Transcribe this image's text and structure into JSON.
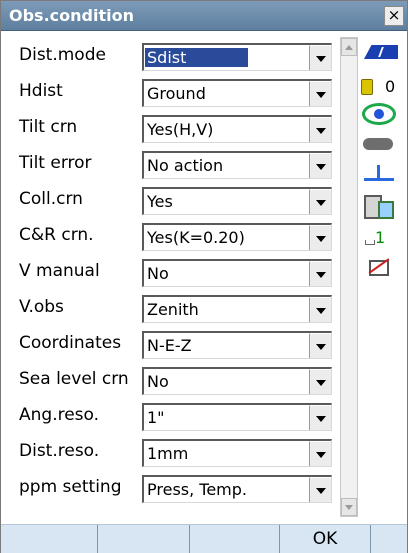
{
  "window": {
    "title": "Obs.condition",
    "close_label": "×"
  },
  "fields": [
    {
      "label": "Dist.mode",
      "value": "Sdist",
      "selected": true
    },
    {
      "label": "Hdist",
      "value": "Ground"
    },
    {
      "label": "Tilt crn",
      "value": "Yes(H,V)"
    },
    {
      "label": "Tilt error",
      "value": "No action"
    },
    {
      "label": "Coll.crn",
      "value": "Yes"
    },
    {
      "label": "C&R crn.",
      "value": "Yes(K=0.20)"
    },
    {
      "label": "V manual",
      "value": "No"
    },
    {
      "label": "V.obs",
      "value": "Zenith"
    },
    {
      "label": "Coordinates",
      "value": "N-E-Z"
    },
    {
      "label": "Sea level crn",
      "value": "No"
    },
    {
      "label": "Ang.reso.",
      "value": "1\""
    },
    {
      "label": "Dist.reso.",
      "value": "1mm"
    },
    {
      "label": "ppm setting",
      "value": "Press, Temp."
    }
  ],
  "status": {
    "prism_constant": "0",
    "input_mode": "1"
  },
  "softkeys": [
    "",
    "",
    "",
    "OK",
    ""
  ],
  "colors": {
    "titlebar": "#6a8aa9",
    "selection": "#2a4a9a",
    "softkey_bar": "#d7e6f2"
  }
}
